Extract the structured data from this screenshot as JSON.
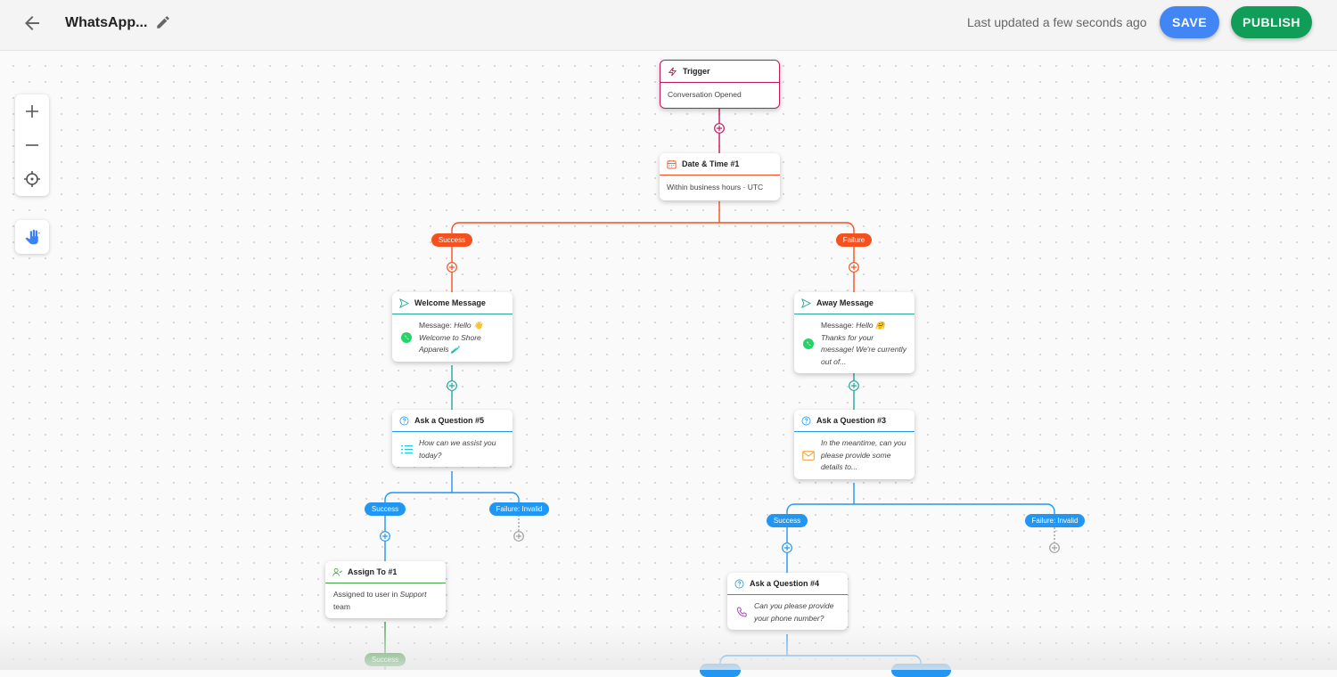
{
  "header": {
    "title": "WhatsApp...",
    "last_updated": "Last updated a few seconds ago",
    "save_label": "SAVE",
    "publish_label": "PUBLISH"
  },
  "controls": {
    "zoom_in": "plus-icon",
    "zoom_out": "minus-icon",
    "recenter": "crosshair-icon",
    "pan": "hand-icon"
  },
  "colors": {
    "trigger": "#c2185b",
    "datetime": "#f4511e",
    "message": "#26a69a",
    "question": "#2196f3",
    "assign": "#43a047",
    "save": "#4285f4",
    "publish": "#0f9d58"
  },
  "nodes": {
    "trigger": {
      "title": "Trigger",
      "body": "Conversation Opened"
    },
    "datetime": {
      "title": "Date & Time #1",
      "body": "Within business hours · UTC"
    },
    "welcome": {
      "title": "Welcome Message",
      "prefix": "Message: ",
      "body": "Hello 👋 Welcome to Shore Apparels 🧪"
    },
    "away": {
      "title": "Away Message",
      "prefix": "Message: ",
      "body": "Hello 🤗 Thanks for your message! We're currently out of..."
    },
    "q5": {
      "title": "Ask a Question #5",
      "body": "How can we assist you today?"
    },
    "q3": {
      "title": "Ask a Question #3",
      "body": "In the meantime, can you please provide some details to..."
    },
    "assign": {
      "title": "Assign To #1",
      "prefix": "Assigned to user in ",
      "team": "Support",
      "suffix": " team"
    },
    "q4": {
      "title": "Ask a Question #4",
      "body": "Can you please provide your phone number?"
    }
  },
  "branches": {
    "success": "Success",
    "failure": "Failure",
    "failure_invalid": "Failure: Invalid"
  }
}
